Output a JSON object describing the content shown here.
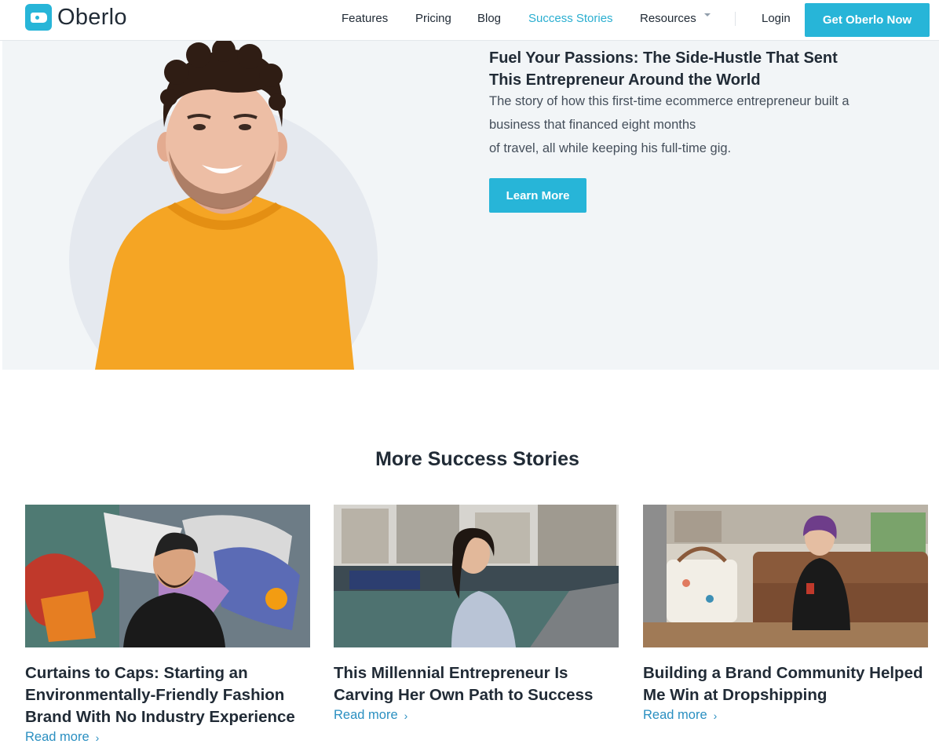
{
  "nav": {
    "logo_text": "Oberlo",
    "links": [
      "Features",
      "Pricing",
      "Blog",
      "Success Stories",
      "Resources"
    ],
    "login": "Login",
    "cta": "Get Oberlo Now"
  },
  "hero": {
    "title_line1": "Fuel Your Passions: The Side-Hustle That Sent",
    "title_line2": "This Entrepreneur Around the World",
    "body_line1": "The story of how this first-time ecommerce entrepreneur built a",
    "body_line2": "business that financed eight months",
    "body_line3": "of travel, all while keeping his full-time gig.",
    "button": "Learn More"
  },
  "more": {
    "title": "More Success Stories",
    "cards": [
      {
        "title_lines": [
          "Curtains to Caps: Starting an",
          "Environmentally-Friendly Fashion",
          "Brand With No Industry Experience"
        ],
        "link": "Read more"
      },
      {
        "title_lines": [
          "This Millennial Entrepreneur Is",
          "Carving Her Own Path to Success"
        ],
        "link": "Read more"
      },
      {
        "title_lines": [
          "Building a Brand Community Helped",
          "Me Win at Dropshipping"
        ],
        "link": "Read more"
      }
    ]
  },
  "colors": {
    "accent": "#27b5d8",
    "link": "#2a8fc1",
    "text": "#212b36",
    "hero_bg": "#f2f5f7"
  },
  "icons": {
    "chevron": "›",
    "caret": "caret-down-icon",
    "logo": "tag-icon"
  }
}
